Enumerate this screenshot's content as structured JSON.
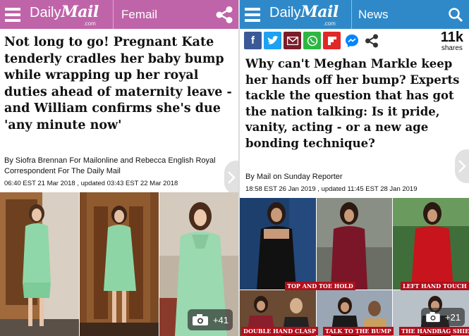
{
  "left": {
    "brand": {
      "daily": "Daily",
      "mail": "Mail",
      "com": ".com"
    },
    "section": "Femail",
    "headline": "Not long to go! Pregnant Kate tenderly cradles her baby bump while wrapping up her royal duties ahead of maternity leave - and William confirms she's due 'any minute now'",
    "byline": "By Siofra Brennan For Mailonline and Rebecca English Royal Correspondent For The Daily Mail",
    "dateline": "06:40 EST 21 Mar 2018 , updated 03:43 EST 22 Mar 2018",
    "gallery_count": "+41",
    "colors": {
      "bar": "#c064a9"
    }
  },
  "right": {
    "brand": {
      "daily": "Daily",
      "mail": "Mail",
      "com": ".com"
    },
    "section": "News",
    "share_count": "11k",
    "share_label": "shares",
    "headline": "Why can't Meghan Markle keep her hands off her bump? Experts tackle the question that has got the nation talking: Is it pride, vanity, acting - or a new age bonding technique?",
    "byline": "By Mail on Sunday Reporter",
    "dateline": "18:58 EST 26 Jan 2019 , updated 11:45 EST 28 Jan 2019",
    "captions": [
      "TOP AND TOE HOLD",
      "LEFT HAND TOUCH",
      "DOUBLE HAND CLASP",
      "TALK TO THE BUMP",
      "THE HANDBAG SHIELD"
    ],
    "gallery_count": "+21",
    "colors": {
      "bar": "#2f89c9"
    }
  },
  "icons": [
    "hamburger-icon",
    "share-icon",
    "search-icon",
    "facebook-icon",
    "twitter-icon",
    "email-icon",
    "whatsapp-icon",
    "flipboard-icon",
    "messenger-icon",
    "camera-icon",
    "chevron-right-icon"
  ]
}
